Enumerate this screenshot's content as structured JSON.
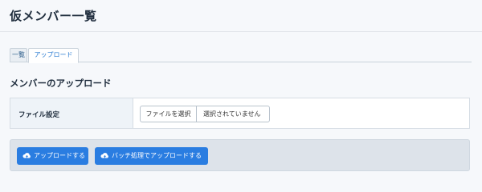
{
  "page": {
    "title": "仮メンバー一覧"
  },
  "tabs": [
    {
      "label": "一覧"
    },
    {
      "label": "アップロード"
    }
  ],
  "section": {
    "title": "メンバーのアップロード"
  },
  "file_setting": {
    "label": "ファイル設定",
    "choose_button": "ファイルを選択",
    "status": "選択されていません"
  },
  "actions": {
    "upload_label": "アップロードする",
    "batch_upload_label": "バッチ処理でアップロードする"
  },
  "colors": {
    "primary": "#2a7de1",
    "background": "#f6f8fb",
    "label_cell": "#eef3f8",
    "action_bar": "#dde3ea"
  },
  "icons": {
    "upload": "cloud-upload-icon"
  }
}
